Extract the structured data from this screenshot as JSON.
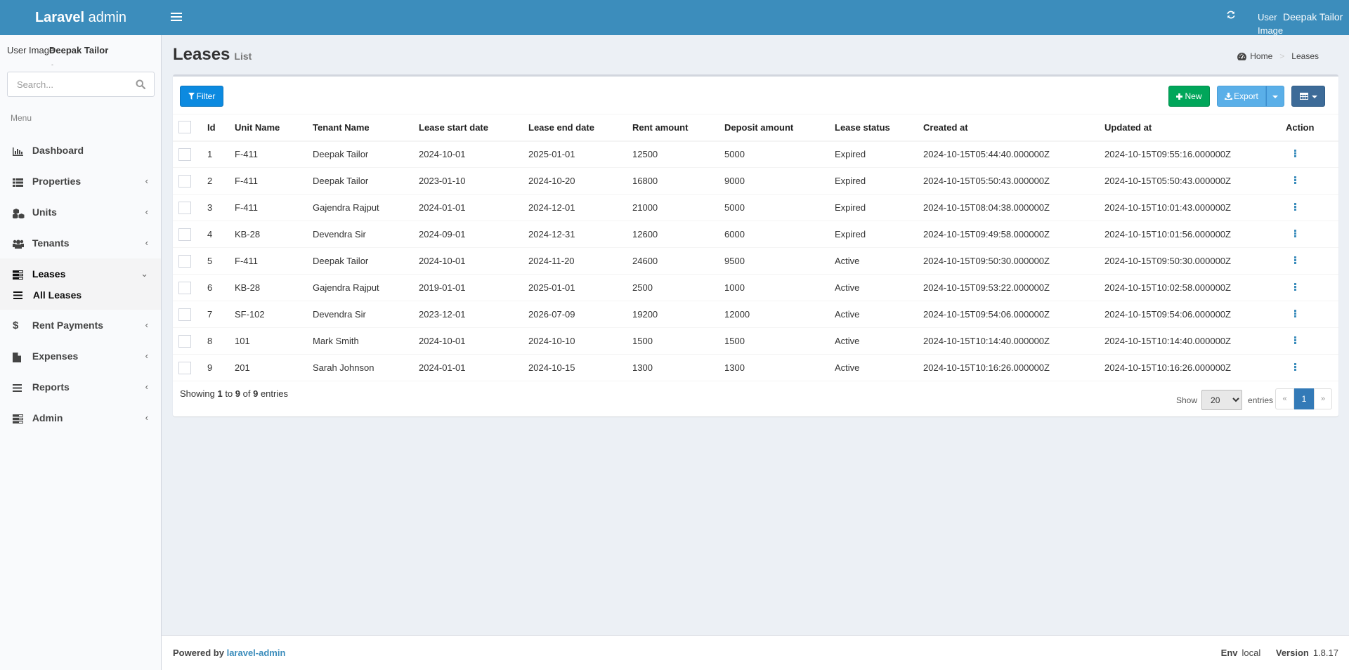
{
  "header": {
    "brand_bold": "Laravel",
    "brand_light": " admin",
    "user_image_alt": "User Image",
    "user_name": "Deepak Tailor"
  },
  "sidebar": {
    "user_image_alt": "User Image",
    "user_name": "Deepak Tailor",
    "user_status": "-",
    "search_placeholder": "Search...",
    "menu_header": "Menu",
    "items": [
      {
        "label": "Dashboard",
        "icon": "bar-chart-icon",
        "has_children": false
      },
      {
        "label": "Properties",
        "icon": "list-icon",
        "has_children": true
      },
      {
        "label": "Units",
        "icon": "cubes-icon",
        "has_children": true
      },
      {
        "label": "Tenants",
        "icon": "users-icon",
        "has_children": true
      },
      {
        "label": "Leases",
        "icon": "server-icon",
        "has_children": true,
        "expanded": true
      },
      {
        "label": "Rent Payments",
        "icon": "dollar-icon",
        "has_children": true
      },
      {
        "label": "Expenses",
        "icon": "file-icon",
        "has_children": true
      },
      {
        "label": "Reports",
        "icon": "bars-icon",
        "has_children": true
      },
      {
        "label": "Admin",
        "icon": "tasks-icon",
        "has_children": true
      }
    ],
    "subitems": [
      {
        "label": "All Leases",
        "icon": "bars-icon"
      }
    ]
  },
  "content": {
    "title": "Leases",
    "subtitle": "List",
    "breadcrumb": {
      "home": "Home",
      "current": "Leases"
    }
  },
  "toolbar": {
    "filter_label": "Filter",
    "new_label": "New",
    "export_label": "Export"
  },
  "table": {
    "columns": [
      "Id",
      "Unit Name",
      "Tenant Name",
      "Lease start date",
      "Lease end date",
      "Rent amount",
      "Deposit amount",
      "Lease status",
      "Created at",
      "Updated at",
      "Action"
    ],
    "rows": [
      [
        "1",
        "F-411",
        "Deepak Tailor",
        "2024-10-01",
        "2025-01-01",
        "12500",
        "5000",
        "Expired",
        "2024-10-15T05:44:40.000000Z",
        "2024-10-15T09:55:16.000000Z"
      ],
      [
        "2",
        "F-411",
        "Deepak Tailor",
        "2023-01-10",
        "2024-10-20",
        "16800",
        "9000",
        "Expired",
        "2024-10-15T05:50:43.000000Z",
        "2024-10-15T05:50:43.000000Z"
      ],
      [
        "3",
        "F-411",
        "Gajendra Rajput",
        "2024-01-01",
        "2024-12-01",
        "21000",
        "5000",
        "Expired",
        "2024-10-15T08:04:38.000000Z",
        "2024-10-15T10:01:43.000000Z"
      ],
      [
        "4",
        "KB-28",
        "Devendra Sir",
        "2024-09-01",
        "2024-12-31",
        "12600",
        "6000",
        "Expired",
        "2024-10-15T09:49:58.000000Z",
        "2024-10-15T10:01:56.000000Z"
      ],
      [
        "5",
        "F-411",
        "Deepak Tailor",
        "2024-10-01",
        "2024-11-20",
        "24600",
        "9500",
        "Active",
        "2024-10-15T09:50:30.000000Z",
        "2024-10-15T09:50:30.000000Z"
      ],
      [
        "6",
        "KB-28",
        "Gajendra Rajput",
        "2019-01-01",
        "2025-01-01",
        "2500",
        "1000",
        "Active",
        "2024-10-15T09:53:22.000000Z",
        "2024-10-15T10:02:58.000000Z"
      ],
      [
        "7",
        "SF-102",
        "Devendra Sir",
        "2023-12-01",
        "2026-07-09",
        "19200",
        "12000",
        "Active",
        "2024-10-15T09:54:06.000000Z",
        "2024-10-15T09:54:06.000000Z"
      ],
      [
        "8",
        "101",
        "Mark Smith",
        "2024-10-01",
        "2024-10-10",
        "1500",
        "1500",
        "Active",
        "2024-10-15T10:14:40.000000Z",
        "2024-10-15T10:14:40.000000Z"
      ],
      [
        "9",
        "201",
        "Sarah Johnson",
        "2024-01-01",
        "2024-10-15",
        "1300",
        "1300",
        "Active",
        "2024-10-15T10:16:26.000000Z",
        "2024-10-15T10:16:26.000000Z"
      ]
    ]
  },
  "pagination": {
    "showing_prefix": "Showing ",
    "from": "1",
    "to_word": " to ",
    "to": "9",
    "of_word": " of ",
    "total": "9",
    "suffix": " entries",
    "show_label": "Show",
    "per_page": "20",
    "entries_label": "entries",
    "prev": "«",
    "current_page": "1",
    "next": "»"
  },
  "footer": {
    "powered_by": "Powered by ",
    "link": "laravel-admin",
    "env_label": "Env",
    "env_value": "local",
    "version_label": "Version",
    "version_value": "1.8.17"
  },
  "colors": {
    "header_bg": "#3c8dbc",
    "filter_btn": "#0c8ae0",
    "new_btn": "#00a65a",
    "export_btn": "#5aafe8",
    "columns_btn": "#3d6b98",
    "page_active": "#337ab7"
  }
}
